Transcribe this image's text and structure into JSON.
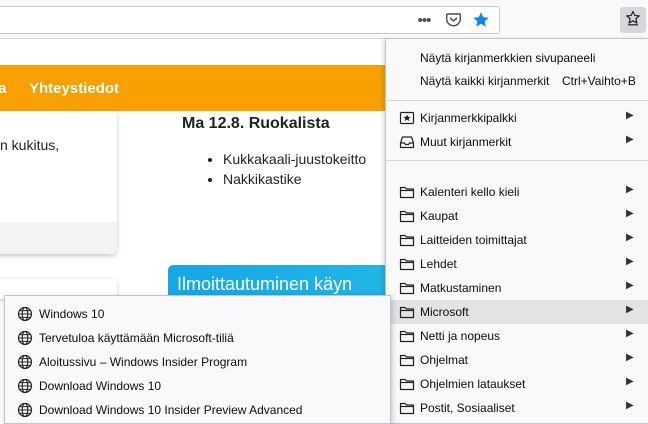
{
  "toolbar": {
    "page_actions_icon": "ellipsis-icon",
    "pocket_icon": "pocket-icon",
    "star_icon": "star-filled-icon",
    "library_icon": "bookmarks-library-icon",
    "star_color": "#0a84ff"
  },
  "page": {
    "nav": {
      "item_partial": "ia",
      "item_contact": "Yhteystiedot"
    },
    "card_text": "n kukitus,",
    "lunch": {
      "title": "Ma 12.8. Ruokalista",
      "items": [
        "Kukkakaali-juustokeitto",
        "Nakkikastike"
      ]
    },
    "signup_text": "Ilmoittautuminen käyn",
    "colors": {
      "nav": "#f7a000",
      "signup": "#14a7e6"
    }
  },
  "bookmarks_menu": {
    "show_sidebar": "Näytä kirjanmerkkien sivupaneeli",
    "show_all": "Näytä kaikki kirjanmerkit",
    "show_all_shortcut": "Ctrl+Vaihto+B",
    "toolbar_folder": "Kirjanmerkkipalkki",
    "other_bookmarks": "Muut kirjanmerkit",
    "folders": [
      "Kalenteri kello kieli",
      "Kaupat",
      "Laitteiden toimittajat",
      "Lehdet",
      "Matkustaminen",
      "Microsoft",
      "Netti ja nopeus",
      "Ohjelmat",
      "Ohjelmien lataukset",
      "Postit, Sosiaaliset"
    ],
    "highlighted_folder": "Microsoft"
  },
  "microsoft_submenu": {
    "items": [
      "Windows 10",
      "Tervetuloa käyttämään Microsoft-tiliä",
      "Aloitussivu – Windows Insider Program",
      "Download Windows 10",
      "Download Windows 10 Insider Preview Advanced"
    ]
  }
}
